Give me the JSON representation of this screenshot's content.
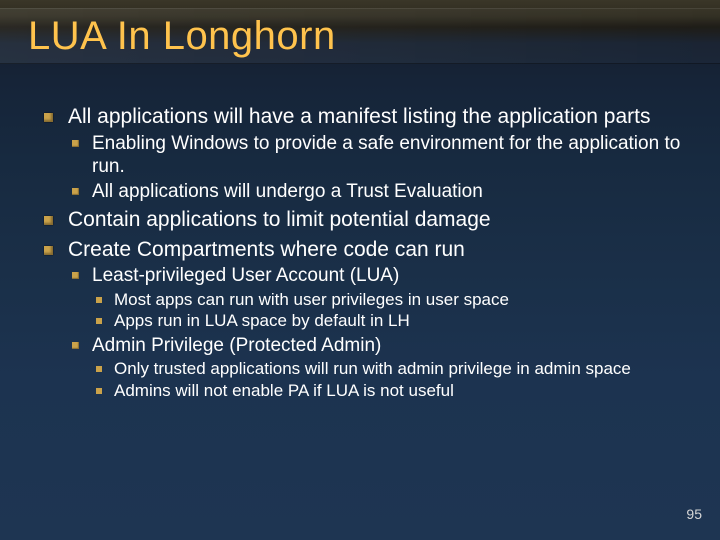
{
  "title": "LUA In Longhorn",
  "colors": {
    "accent": "#caa24a",
    "title": "#ffc34d"
  },
  "page_number": "95",
  "bullets": [
    {
      "text": "All applications will have a manifest listing the application parts",
      "children": [
        {
          "text": "Enabling Windows to provide a safe environment for the application to run."
        },
        {
          "text": "All applications will undergo a Trust Evaluation"
        }
      ]
    },
    {
      "text": "Contain applications to limit potential damage"
    },
    {
      "text": "Create Compartments where code can run",
      "children": [
        {
          "text": "Least-privileged User Account (LUA)",
          "children": [
            {
              "text": "Most apps can run with user privileges in user space"
            },
            {
              "text": "Apps run in LUA space by default in LH"
            }
          ]
        },
        {
          "text": "Admin Privilege (Protected Admin)",
          "children": [
            {
              "text": "Only trusted applications will run with admin privilege in admin space"
            },
            {
              "text": "Admins will not enable PA if LUA is not useful"
            }
          ]
        }
      ]
    }
  ]
}
